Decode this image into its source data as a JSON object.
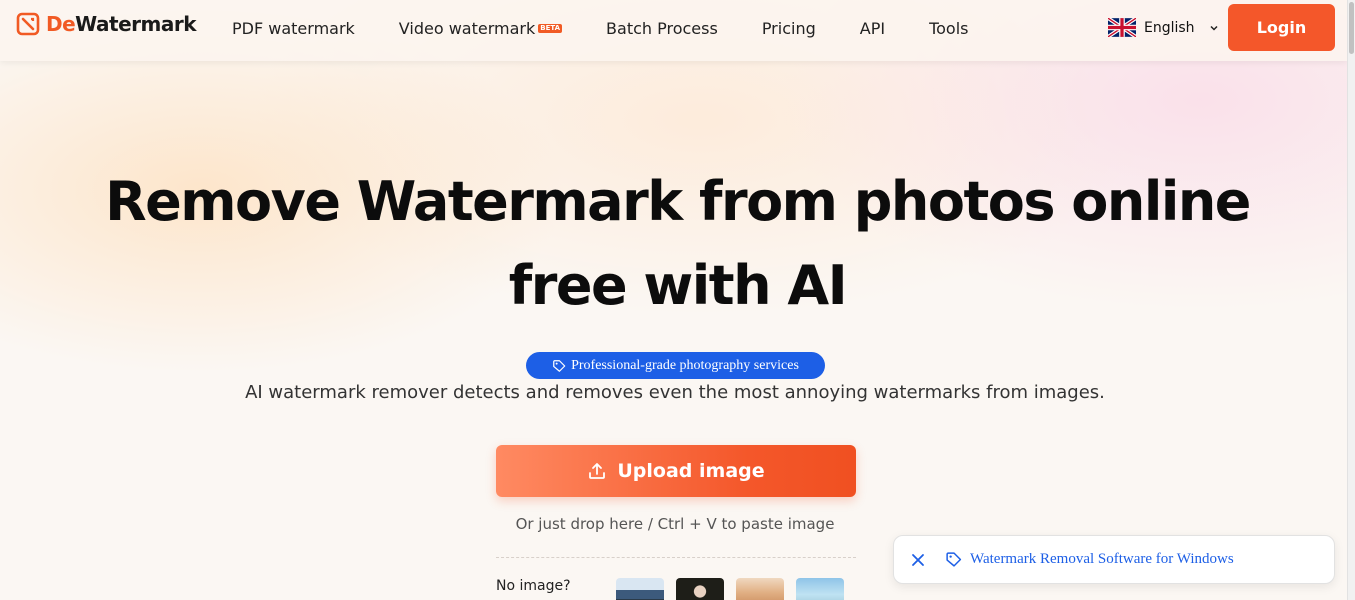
{
  "header": {
    "logo_prefix": "De",
    "logo_suffix": "Watermark",
    "nav": [
      {
        "label": "PDF watermark"
      },
      {
        "label": "Video watermark",
        "badge": "BETA"
      },
      {
        "label": "Batch Process"
      },
      {
        "label": "Pricing"
      },
      {
        "label": "API"
      },
      {
        "label": "Tools"
      }
    ],
    "language": "English",
    "login_label": "Login"
  },
  "hero": {
    "title_line1": "Remove Watermark from photos online",
    "title_line2": "free with AI",
    "badge": "Professional-grade photography services",
    "subtitle": "AI watermark remover detects and removes even the most annoying watermarks from images.",
    "upload_label": "Upload image",
    "hint": "Or just drop here / Ctrl + V to paste image",
    "no_image_label": "No image?"
  },
  "toast": {
    "link_text": "Watermark Removal Software for Windows"
  },
  "colors": {
    "accent": "#f4572a",
    "badge_blue": "#1d5fe6"
  },
  "icons": {
    "logo": "dewatermark-logo-icon",
    "flag": "uk-flag-icon",
    "chevron": "chevron-down-icon",
    "upload": "upload-icon",
    "tag": "tag-icon",
    "close": "close-icon"
  }
}
